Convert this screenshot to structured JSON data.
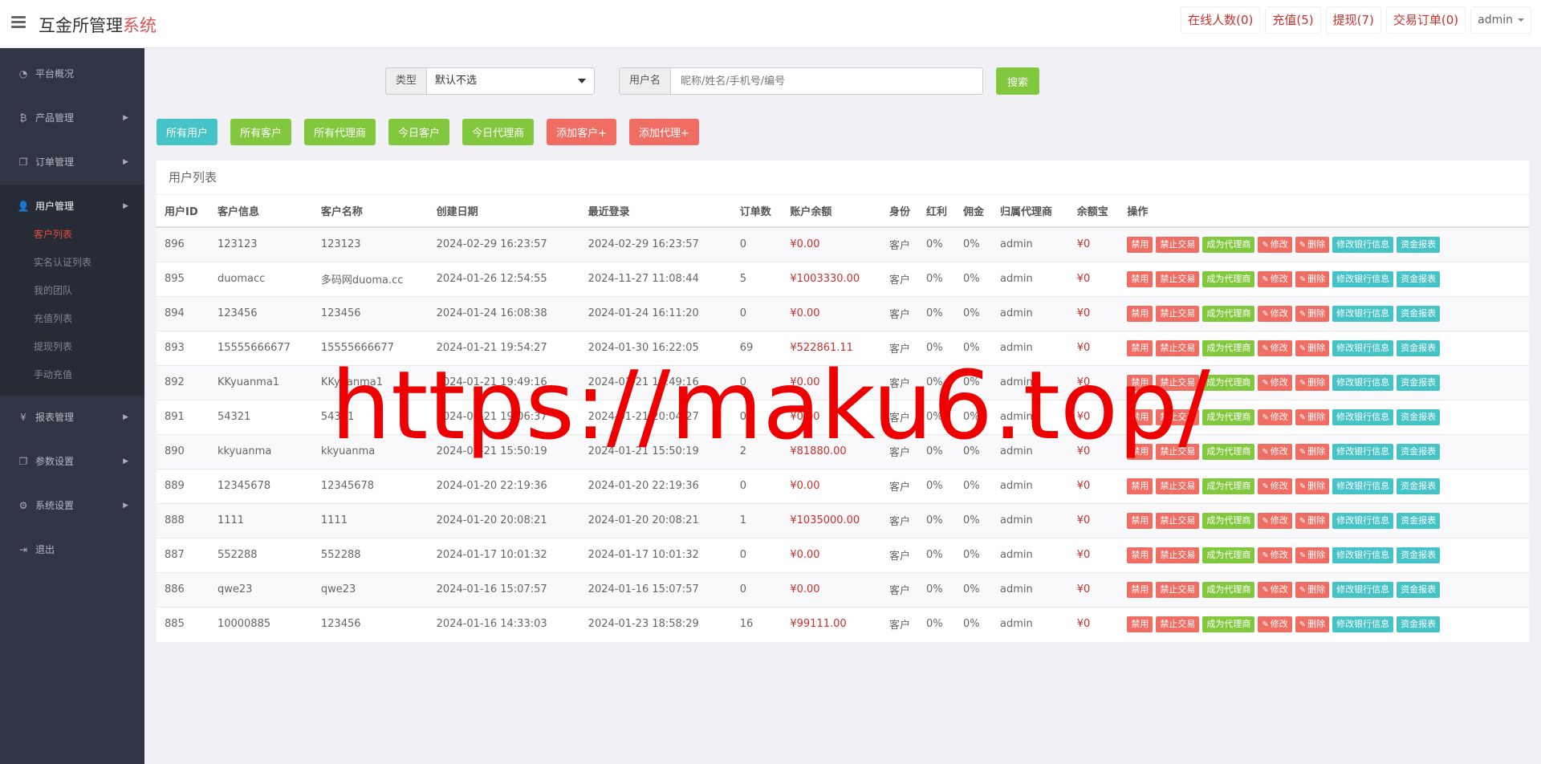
{
  "header": {
    "brand_main": "互金所管理",
    "brand_accent": "系统",
    "buttons": [
      "在线人数(0)",
      "充值(5)",
      "提现(7)",
      "交易订单(0)"
    ],
    "admin": "admin"
  },
  "sidebar": {
    "items": [
      {
        "label": "平台概况",
        "icon": "dashboard-icon",
        "glyph": "◔"
      },
      {
        "label": "产品管理",
        "icon": "bitcoin-icon",
        "glyph": "₿",
        "arrow": "▶"
      },
      {
        "label": "订单管理",
        "icon": "files-icon",
        "glyph": "❐",
        "arrow": "▶"
      }
    ],
    "active_group": {
      "label": "用户管理",
      "icon": "user-icon",
      "glyph": "👤",
      "arrow": "▶",
      "sub": [
        "客户列表",
        "实名认证列表",
        "我的团队",
        "充值列表",
        "提现列表",
        "手动充值"
      ]
    },
    "items_after": [
      {
        "label": "报表管理",
        "icon": "yen-icon",
        "glyph": "¥",
        "arrow": "▶"
      },
      {
        "label": "参数设置",
        "icon": "files-icon",
        "glyph": "❐",
        "arrow": "▶"
      },
      {
        "label": "系统设置",
        "icon": "gears-icon",
        "glyph": "⚙",
        "arrow": "▶"
      },
      {
        "label": "退出",
        "icon": "signout-icon",
        "glyph": "⇥"
      }
    ]
  },
  "search": {
    "type_label": "类型",
    "type_value": "默认不选",
    "user_label": "用户名",
    "user_placeholder": "昵称/姓名/手机号/编号",
    "submit": "搜索"
  },
  "filters": [
    {
      "label": "所有用户",
      "color": "teal"
    },
    {
      "label": "所有客户",
      "color": "green"
    },
    {
      "label": "所有代理商",
      "color": "green"
    },
    {
      "label": "今日客户",
      "color": "green"
    },
    {
      "label": "今日代理商",
      "color": "green"
    },
    {
      "label": "添加客户+",
      "color": "red"
    },
    {
      "label": "添加代理+",
      "color": "red"
    }
  ],
  "panel_title": "用户列表",
  "table": {
    "columns": [
      "用户ID",
      "客户信息",
      "客户名称",
      "创建日期",
      "最近登录",
      "订单数",
      "账户余额",
      "身份",
      "红利",
      "佣金",
      "归属代理商",
      "余额宝",
      "操作"
    ],
    "actions": [
      {
        "label": "禁用",
        "color": "red"
      },
      {
        "label": "禁止交易",
        "color": "red"
      },
      {
        "label": "成为代理商",
        "color": "green"
      },
      {
        "label": "修改",
        "color": "red",
        "pen": true
      },
      {
        "label": "删除",
        "color": "red",
        "pen": true
      },
      {
        "label": "修改银行信息",
        "color": "teal"
      },
      {
        "label": "资金报表",
        "color": "teal"
      }
    ],
    "rows": [
      [
        "896",
        "123123",
        "123123",
        "2024-02-29 16:23:57",
        "2024-02-29 16:23:57",
        "0",
        "¥0.00",
        "客户",
        "0%",
        "0%",
        "admin",
        "¥0"
      ],
      [
        "895",
        "duomacc",
        "多码网duoma.cc",
        "2024-01-26 12:54:55",
        "2024-11-27 11:08:44",
        "5",
        "¥1003330.00",
        "客户",
        "0%",
        "0%",
        "admin",
        "¥0"
      ],
      [
        "894",
        "123456",
        "123456",
        "2024-01-24 16:08:38",
        "2024-01-24 16:11:20",
        "0",
        "¥0.00",
        "客户",
        "0%",
        "0%",
        "admin",
        "¥0"
      ],
      [
        "893",
        "15555666677",
        "15555666677",
        "2024-01-21 19:54:27",
        "2024-01-30 16:22:05",
        "69",
        "¥522861.11",
        "客户",
        "0%",
        "0%",
        "admin",
        "¥0"
      ],
      [
        "892",
        "KKyuanma1",
        "KKyuanma1",
        "2024-01-21 19:49:16",
        "2024-01-21 19:49:16",
        "0",
        "¥0.00",
        "客户",
        "0%",
        "0%",
        "admin",
        "¥0"
      ],
      [
        "891",
        "54321",
        "54321",
        "2024-01-21 19:06:37",
        "2024-01-21 20:04:27",
        "0",
        "¥0.00",
        "客户",
        "0%",
        "0%",
        "admin",
        "¥0"
      ],
      [
        "890",
        "kkyuanma",
        "kkyuanma",
        "2024-01-21 15:50:19",
        "2024-01-21 15:50:19",
        "2",
        "¥81880.00",
        "客户",
        "0%",
        "0%",
        "admin",
        "¥0"
      ],
      [
        "889",
        "12345678",
        "12345678",
        "2024-01-20 22:19:36",
        "2024-01-20 22:19:36",
        "0",
        "¥0.00",
        "客户",
        "0%",
        "0%",
        "admin",
        "¥0"
      ],
      [
        "888",
        "1111",
        "1111",
        "2024-01-20 20:08:21",
        "2024-01-20 20:08:21",
        "1",
        "¥1035000.00",
        "客户",
        "0%",
        "0%",
        "admin",
        "¥0"
      ],
      [
        "887",
        "552288",
        "552288",
        "2024-01-17 10:01:32",
        "2024-01-17 10:01:32",
        "0",
        "¥0.00",
        "客户",
        "0%",
        "0%",
        "admin",
        "¥0"
      ],
      [
        "886",
        "qwe23",
        "qwe23",
        "2024-01-16 15:07:57",
        "2024-01-16 15:07:57",
        "0",
        "¥0.00",
        "客户",
        "0%",
        "0%",
        "admin",
        "¥0"
      ],
      [
        "885",
        "10000885",
        "123456",
        "2024-01-16 14:33:03",
        "2024-01-23 18:58:29",
        "16",
        "¥99111.00",
        "客户",
        "0%",
        "0%",
        "admin",
        "¥0"
      ]
    ]
  },
  "watermark": "https://maku6.top/"
}
